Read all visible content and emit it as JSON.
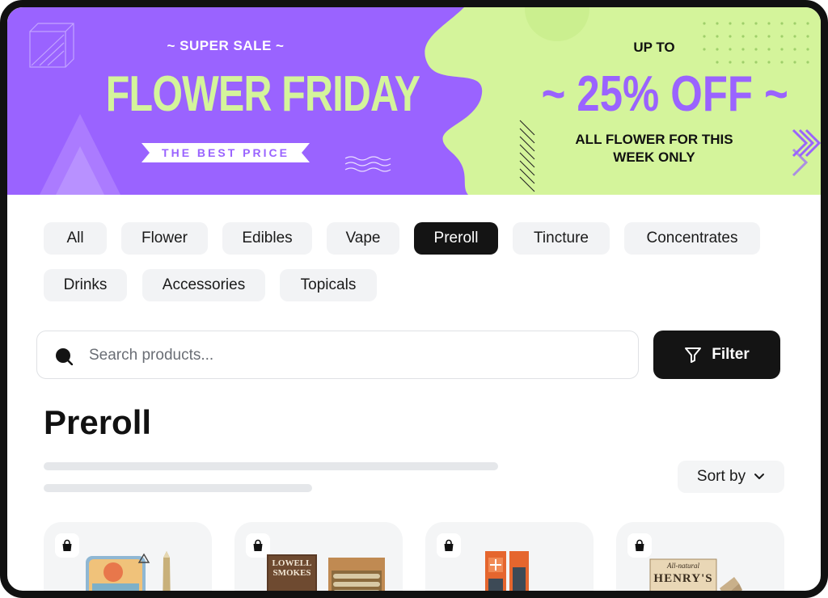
{
  "banner": {
    "super_sale": "~ SUPER SALE ~",
    "headline": "FLOWER FRIDAY",
    "tagline": "THE BEST PRICE",
    "up_to": "UP TO",
    "discount": "~ 25% OFF ~",
    "offer_line1": "ALL FLOWER FOR THIS",
    "offer_line2": "WEEK ONLY",
    "colors": {
      "purple": "#9a63ff",
      "lime": "#d4f49b"
    }
  },
  "categories": [
    {
      "label": "All",
      "active": false
    },
    {
      "label": "Flower",
      "active": false
    },
    {
      "label": "Edibles",
      "active": false
    },
    {
      "label": "Vape",
      "active": false
    },
    {
      "label": "Preroll",
      "active": true
    },
    {
      "label": "Tincture",
      "active": false
    },
    {
      "label": "Concentrates",
      "active": false
    },
    {
      "label": "Drinks",
      "active": false
    },
    {
      "label": "Accessories",
      "active": false
    },
    {
      "label": "Topicals",
      "active": false
    }
  ],
  "search": {
    "placeholder": "Search products...",
    "value": "",
    "icon": "search-icon"
  },
  "filter": {
    "label": "Filter",
    "icon": "filter-icon"
  },
  "page": {
    "title": "Preroll"
  },
  "sort": {
    "label": "Sort by",
    "icon": "chevron-down-icon"
  },
  "products": [
    {
      "package_text": "",
      "icon": "bag-icon"
    },
    {
      "package_text": "LOWELL SMOKES",
      "icon": "bag-icon"
    },
    {
      "package_text": "",
      "icon": "bag-icon"
    },
    {
      "package_text": "HENRY'S",
      "package_subtext": "All-natural",
      "icon": "bag-icon"
    }
  ]
}
